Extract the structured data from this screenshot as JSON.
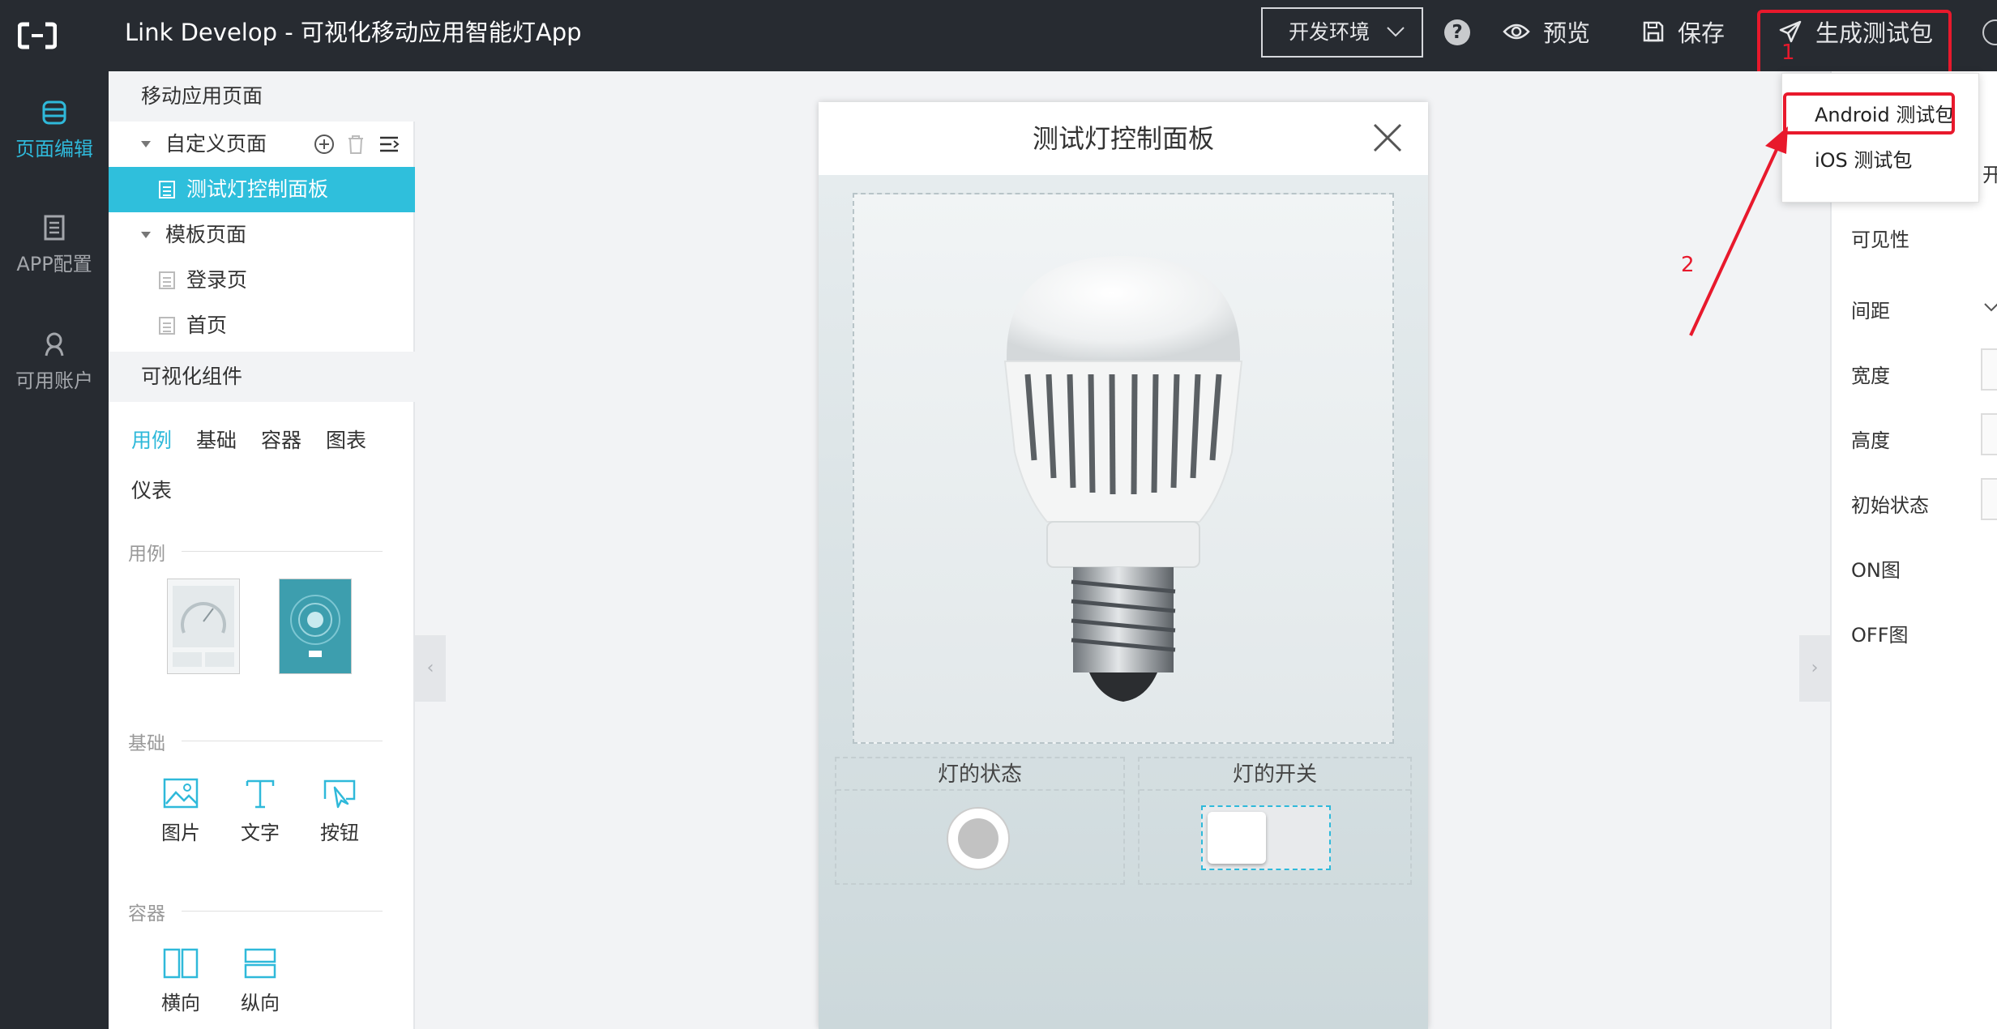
{
  "header": {
    "title": "Link Develop - 可视化移动应用智能灯App",
    "env_selector": "开发环境",
    "help": "?",
    "preview": "预览",
    "save": "保存",
    "build": "生成测试包"
  },
  "left_nav": [
    {
      "label": "页面编辑",
      "icon": "layers-icon",
      "active": true
    },
    {
      "label": "APP配置",
      "icon": "document-icon",
      "active": false
    },
    {
      "label": "可用账户",
      "icon": "user-icon",
      "active": false
    }
  ],
  "page_tree": {
    "title": "移动应用页面",
    "custom_group": "自定义页面",
    "custom_pages": [
      "测试灯控制面板"
    ],
    "template_group": "模板页面",
    "template_pages": [
      "登录页",
      "首页"
    ]
  },
  "components": {
    "title": "可视化组件",
    "tabs": [
      "用例",
      "基础",
      "容器",
      "图表",
      "仪表"
    ],
    "active_tab": "用例",
    "sections": {
      "examples": "用例",
      "basic": "基础",
      "container": "容器"
    },
    "basic_items": [
      "图片",
      "文字",
      "按钮"
    ],
    "container_items": [
      "横向",
      "纵向"
    ]
  },
  "phone": {
    "title": "测试灯控制面板",
    "state_label": "灯的状态",
    "switch_label": "灯的开关"
  },
  "properties": {
    "partial": "开",
    "labels": [
      "可见性",
      "间距",
      "宽度",
      "高度",
      "初始状态",
      "ON图",
      "OFF图"
    ]
  },
  "build_menu": {
    "items": [
      "Android 测试包",
      "iOS 测试包"
    ]
  },
  "annotations": {
    "step1": "1",
    "step2": "2",
    "color": "#e8192c"
  },
  "colors": {
    "accent": "#2fbfdc",
    "topbar": "#272b31",
    "highlight": "#e8192c"
  }
}
